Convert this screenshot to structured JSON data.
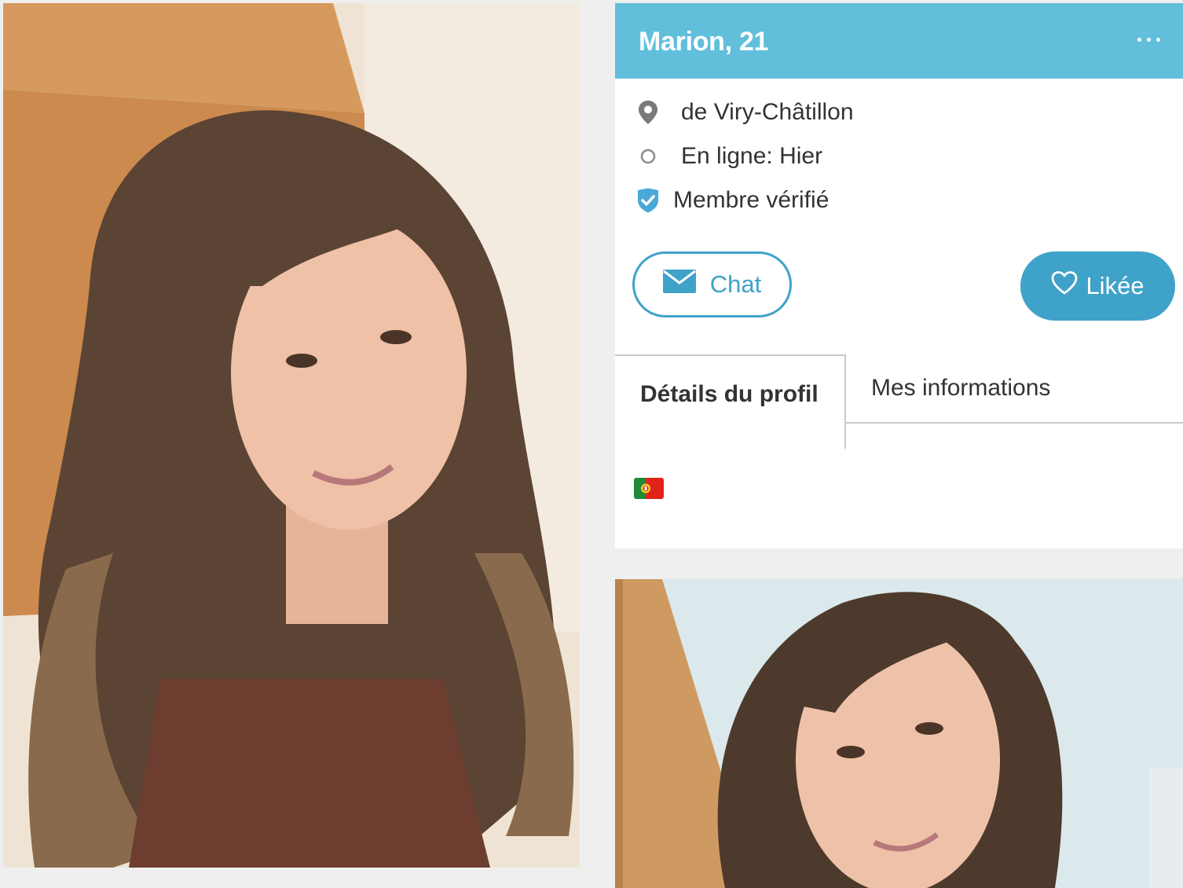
{
  "profile": {
    "title": "Marion, 21",
    "location": "de Viry-Châtillon",
    "online_status": "En ligne: Hier",
    "verified_label": "Membre vérifié"
  },
  "actions": {
    "chat_label": "Chat",
    "like_label": "Likée"
  },
  "tabs": {
    "details_label": "Détails du profil",
    "info_label": "Mes informations"
  },
  "icons": {
    "more": "more-dots-icon",
    "location": "map-pin-icon",
    "online": "circle-icon",
    "verified": "shield-check-icon",
    "chat": "envelope-icon",
    "like": "heart-icon",
    "flag": "portugal-flag-icon"
  },
  "colors": {
    "header": "#62bfdc",
    "accent": "#3fa2c9",
    "background": "#efefef"
  }
}
